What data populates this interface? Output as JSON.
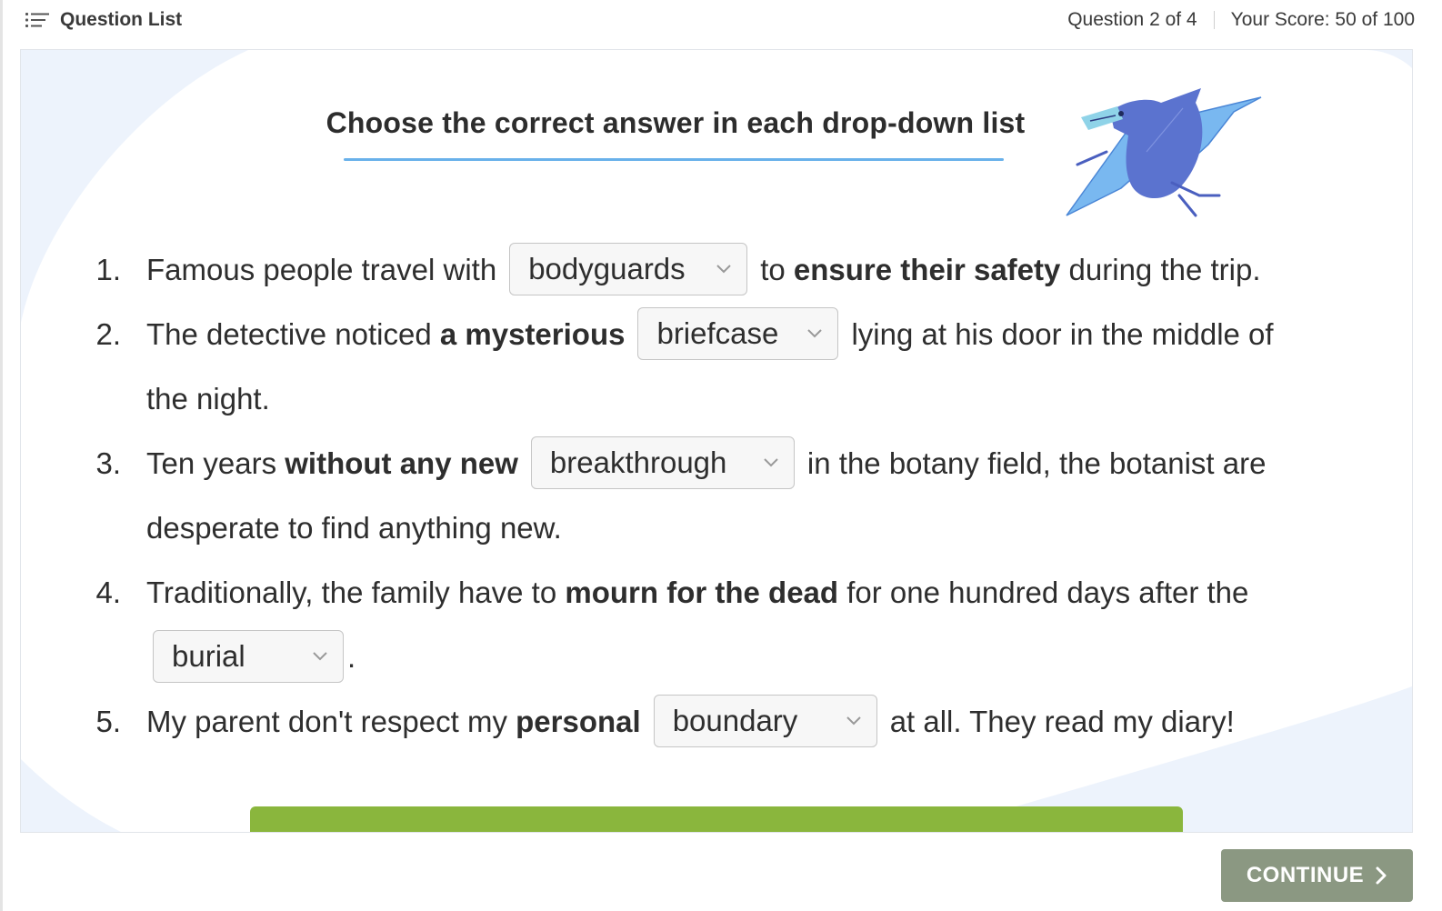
{
  "topbar": {
    "question_list_label": "Question List",
    "question_progress": "Question 2 of 4",
    "score": "Your Score: 50 of 100"
  },
  "main": {
    "heading": "Choose the correct answer in each drop-down list",
    "questions": [
      {
        "num": "1.",
        "before": "Famous people travel with",
        "dropdown": "bodyguards",
        "after_plain": "to",
        "after_bold": "ensure their safety",
        "after_rest": "during the trip."
      },
      {
        "num": "2.",
        "before": "The detective noticed",
        "before_bold": "a mysterious",
        "dropdown": "briefcase",
        "after": "lying at his door in the middle of",
        "continuation": "the night."
      },
      {
        "num": "3.",
        "before": "Ten years",
        "before_bold": "without any new",
        "dropdown": "breakthrough",
        "after": "in the botany field, the botanist are",
        "continuation": "desperate to find anything new."
      },
      {
        "num": "4.",
        "before": "Traditionally, the family have to",
        "bold": "mourn for the dead",
        "after": "for one hundred days after the",
        "dropdown": "burial",
        "end": "."
      },
      {
        "num": "5.",
        "before": "My parent don't respect my",
        "before_bold": "personal",
        "dropdown": "boundary",
        "after": "at all. They read my diary!"
      }
    ]
  },
  "footer": {
    "continue_label": "CONTINUE"
  },
  "colors": {
    "panel_bg": "#edf3fc",
    "accent_underline": "#69b1ea",
    "green_button": "#8ab63d",
    "continue_button": "#8b9882"
  },
  "icons": [
    "list-icon",
    "chevron-down-icon",
    "chevron-right-icon",
    "pterodactyl-illustration"
  ]
}
